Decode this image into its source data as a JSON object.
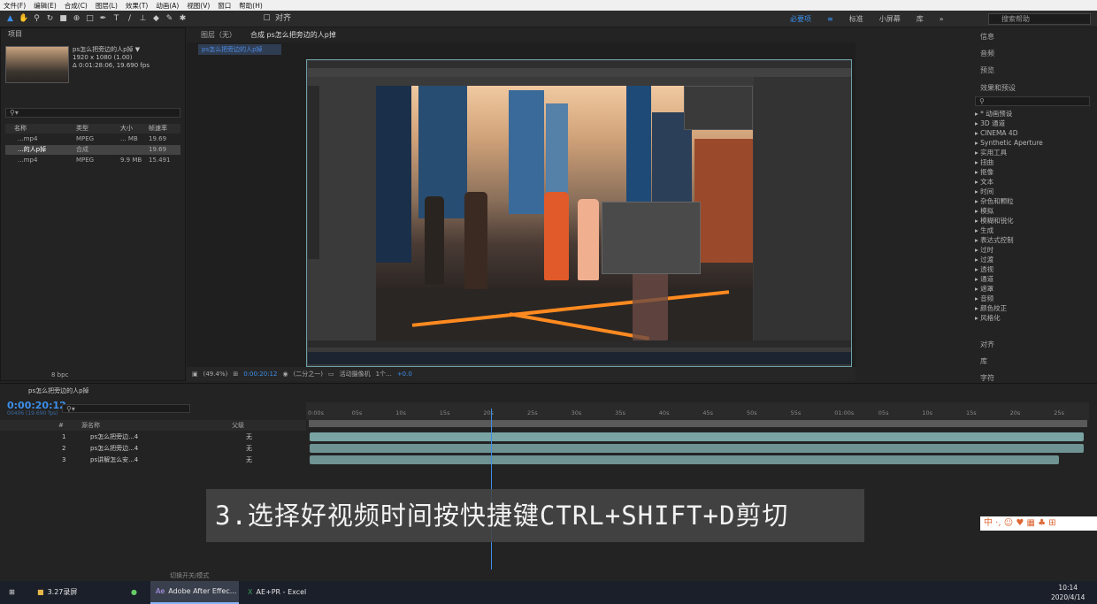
{
  "menu": [
    "文件(F)",
    "编辑(E)",
    "合成(C)",
    "图层(L)",
    "效果(T)",
    "动画(A)",
    "视图(V)",
    "窗口",
    "帮助(H)"
  ],
  "toolbar": {
    "snap_label": "对齐",
    "workspaces": [
      "必要项",
      "标准",
      "小屏幕",
      "库"
    ],
    "help_placeholder": "搜索帮助"
  },
  "project": {
    "title": "项目",
    "item_name": "ps怎么把旁边的人p掉 ▼",
    "item_res": "1920 x 1080 (1.00)",
    "item_dur": "Δ 0:01:28:06, 19.690 fps",
    "columns": [
      "名称",
      "类型",
      "大小",
      "帧速率"
    ],
    "rows": [
      {
        "name": "...mp4",
        "type": "MPEG",
        "size": "... MB",
        "fps": "19.69"
      },
      {
        "name": "...的人p掉",
        "type": "合成",
        "size": "",
        "fps": "19.69"
      },
      {
        "name": "...mp4",
        "type": "MPEG",
        "size": "9.9 MB",
        "fps": "15.491"
      }
    ],
    "bpc": "8 bpc"
  },
  "composition": {
    "tab_layer": "图层（无）",
    "tab_comp": "合成 ps怎么把旁边的人p掉",
    "subtab": "ps怎么把旁边的人p掉",
    "zoom": "(49.4%)",
    "time": "0:00:20:12",
    "resolution": "(二分之一)",
    "camera": "活动摄像机",
    "views": "1个...",
    "exposure": "+0.0"
  },
  "right_panel": {
    "items": [
      "信息",
      "音频",
      "预览",
      "效果和预设"
    ],
    "effects": [
      "▸ * 动画预设",
      "▸ 3D 通道",
      "▸ CINEMA 4D",
      "▸ Synthetic Aperture",
      "▸ 实用工具",
      "▸ 扭曲",
      "▸ 抠像",
      "▸ 文本",
      "▸ 时间",
      "▸ 杂色和颗粒",
      "▸ 模拟",
      "▸ 模糊和锐化",
      "▸ 生成",
      "▸ 表达式控制",
      "▸ 过时",
      "▸ 过渡",
      "▸ 透视",
      "▸ 通道",
      "▸ 遮罩",
      "▸ 音频",
      "▸ 颜色校正",
      "▸ 风格化"
    ],
    "bottom": [
      "对齐",
      "库",
      "字符"
    ]
  },
  "timeline": {
    "tab": "ps怎么把旁边的人p掉",
    "timecode": "0:00:20:12",
    "fps": "00406 (19.690 fps)",
    "columns": [
      "#",
      "源名称",
      "父级"
    ],
    "layers": [
      {
        "num": "1",
        "name": "ps怎么把旁边...4",
        "parent": "无"
      },
      {
        "num": "2",
        "name": "ps怎么把旁边...4",
        "parent": "无"
      },
      {
        "num": "3",
        "name": "ps讲解怎么安...4",
        "parent": "无"
      }
    ],
    "ticks": [
      "0:00s",
      "05s",
      "10s",
      "15s",
      "20s",
      "25s",
      "30s",
      "35s",
      "40s",
      "45s",
      "50s",
      "55s",
      "01:00s",
      "05s",
      "10s",
      "15s",
      "20s",
      "25s"
    ],
    "mode_toggle": "切换开关/模式"
  },
  "subtitle": "3.选择好视频时间按快捷键CTRL+SHIFT+D剪切",
  "ime": "中 ·, ☺ ♥ ▦ ♣ ⊞",
  "taskbar": {
    "items": [
      "3.27录屏",
      "Adobe After Effec...",
      "AE+PR - Excel"
    ],
    "time": "10:14",
    "date": "2020/4/14"
  },
  "colors": {
    "accent": "#3b8eea",
    "bar": "#7aa3a3"
  }
}
